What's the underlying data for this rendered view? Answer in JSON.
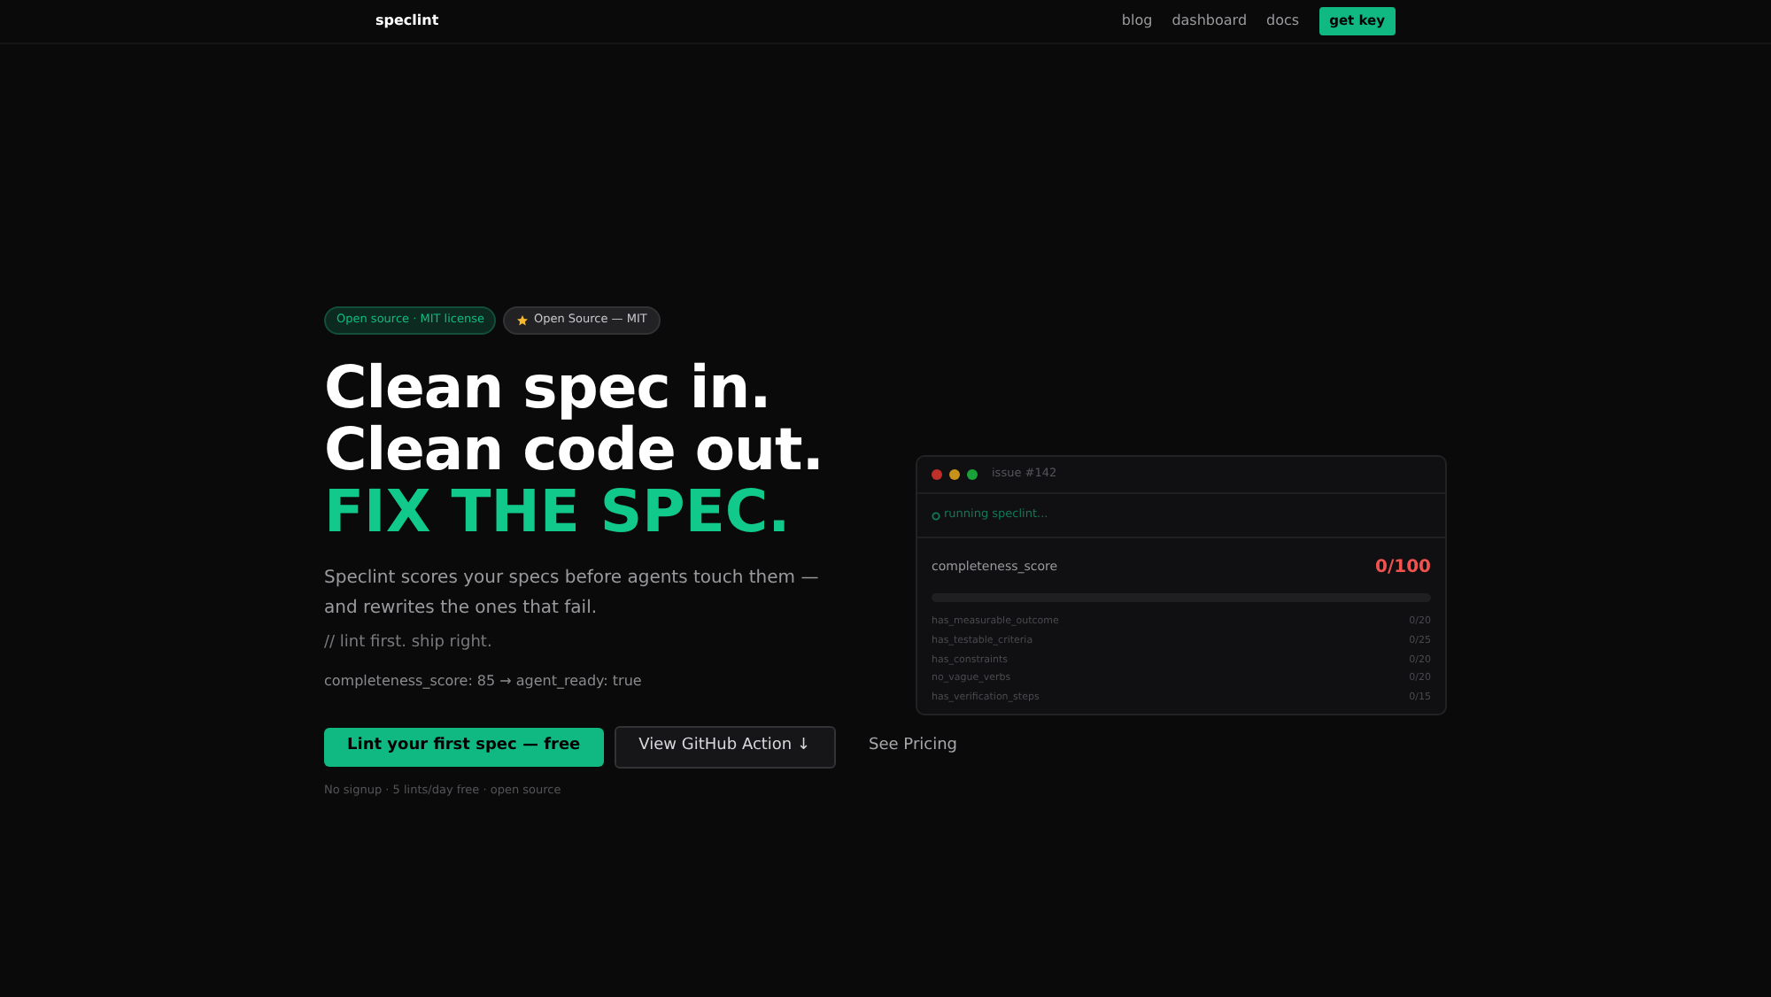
{
  "nav": {
    "logo": "speclint",
    "links": [
      "blog",
      "dashboard",
      "docs"
    ],
    "cta": "get key"
  },
  "badges": [
    {
      "kind": "license",
      "text": "Open source · MIT license"
    },
    {
      "kind": "star",
      "text": "Open Source — MIT"
    }
  ],
  "headline": [
    "Clean spec in.",
    "Clean code out."
  ],
  "accent": "FIX THE SPEC.",
  "subtitle": "Speclint scores your specs before agents touch them — and rewrites the ones that fail.",
  "comment": "// lint first. ship right.",
  "sample": "completeness_score: 85 → agent_ready: true",
  "buttons": [
    {
      "kind": "primary",
      "label": "Lint your first spec — free"
    },
    {
      "kind": "secondary",
      "label": "View GitHub Action ↓"
    },
    {
      "kind": "link",
      "label": "See Pricing"
    }
  ],
  "footnote": "No signup · 5 lints/day free · open source",
  "terminal": {
    "title": "issue #142",
    "status": "running speclint...",
    "score_label": "completeness_score",
    "score": "0/100",
    "level": 0,
    "checks": [
      {
        "name": "has_measurable_outcome",
        "score": "0/20"
      },
      {
        "name": "has_testable_criteria",
        "score": "0/25"
      },
      {
        "name": "has_constraints",
        "score": "0/20"
      },
      {
        "name": "no_vague_verbs",
        "score": "0/20"
      },
      {
        "name": "has_verification_steps",
        "score": "0/15"
      }
    ]
  }
}
